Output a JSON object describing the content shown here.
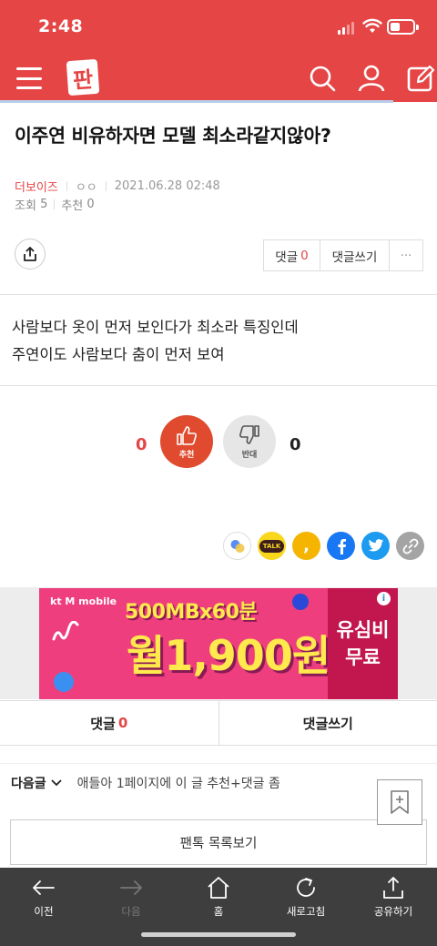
{
  "status_bar": {
    "time": "2:48"
  },
  "app": {
    "logo": "판",
    "icons": [
      "menu-icon",
      "search-icon",
      "user-icon",
      "write-icon"
    ]
  },
  "post": {
    "title": "이주연 비유하자면 모델 최소라같지않아?",
    "author": "더보이즈",
    "author_sub": "ㅇㅇ",
    "datetime": "2021.06.28 02:48",
    "views_label": "조회",
    "views": "5",
    "recommend_label": "추천",
    "recommend": "0",
    "body_lines": [
      "사람보다 옷이 먼저 보인다가 최소라 특징인데",
      "주연이도 사람보다 춤이 먼저 보여"
    ]
  },
  "actions": {
    "comment_label": "댓글",
    "comment_count": "0",
    "write_comment": "댓글쓰기",
    "more": "···"
  },
  "vote": {
    "up_count": "0",
    "up_label": "추천",
    "down_count": "0",
    "down_label": "반대"
  },
  "share": {
    "kakaotalk_label": "TALK",
    "kakaostory_label": ","
  },
  "ad": {
    "brand": "kt M mobile",
    "line1": "500MBx60분",
    "line2": "월1,900원",
    "right_line1": "유심비",
    "right_line2": "무료",
    "info": "i"
  },
  "comment_bar": {
    "comment_label": "댓글",
    "comment_count": "0",
    "write_label": "댓글쓰기"
  },
  "next_post": {
    "label": "다음글",
    "title": "애들아 1페이지에 이 글 추천+댓글 좀"
  },
  "list_button": "팬톡 목록보기",
  "bottom_nav": [
    {
      "label": "이전",
      "icon": "arrow-left-icon"
    },
    {
      "label": "다음",
      "icon": "arrow-right-icon"
    },
    {
      "label": "홈",
      "icon": "home-icon"
    },
    {
      "label": "새로고침",
      "icon": "refresh-icon"
    },
    {
      "label": "공유하기",
      "icon": "share-icon"
    }
  ],
  "colors": {
    "brand_red": "#e54545",
    "nav_dark": "#3e3e3e"
  }
}
